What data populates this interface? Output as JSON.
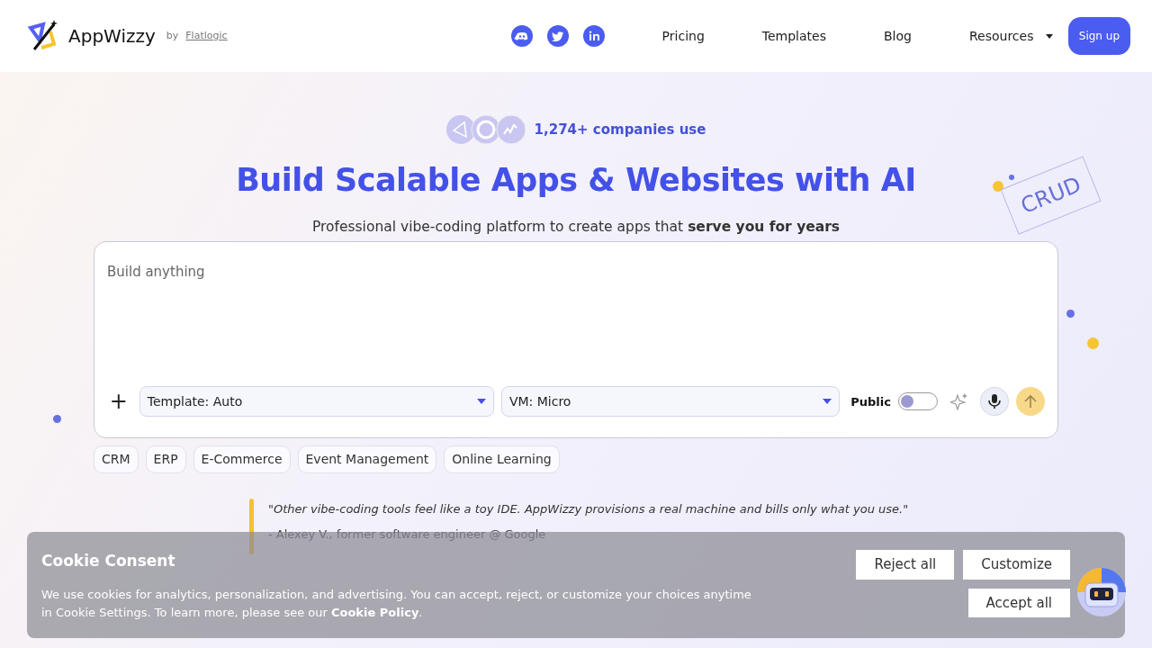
{
  "brand": {
    "name": "AppWizzy",
    "by": "by",
    "company": "Flatlogic"
  },
  "nav": {
    "links": [
      {
        "label": "Pricing",
        "kind": "link"
      },
      {
        "label": "Templates",
        "kind": "link"
      },
      {
        "label": "Blog",
        "kind": "link"
      },
      {
        "label": "Resources",
        "kind": "dropdown"
      }
    ],
    "signup": "Sign up"
  },
  "social": [
    {
      "kind": "discord"
    },
    {
      "kind": "twitter"
    },
    {
      "kind": "linkedin"
    }
  ],
  "hero": {
    "usage": "1,274+ companies use",
    "title": "Build Scalable Apps & Websites with AI",
    "subtitle": "Professional vibe-coding platform to create apps that **serve you for years**",
    "deco_label": "CRUD"
  },
  "prompt": {
    "placeholder": "Build anything",
    "add": "+",
    "template": "Template: Auto",
    "vm": "VM: Micro",
    "public_label": "Public",
    "public_on": false
  },
  "tags": [
    "CRM",
    "ERP",
    "E-Commerce",
    "Event Management",
    "Online Learning"
  ],
  "quote": {
    "text": "\"Other vibe-coding tools feel like a toy IDE. AppWizzy provisions a real machine and bills only what you use.\"",
    "author": "- Alexey V., former software engineer @ Google"
  },
  "cookie": {
    "title": "Cookie Consent",
    "text": "We use cookies for analytics, personalization, and advertising. You can accept, reject, or customize your choices anytime in Cookie Settings. To learn more, please see our **Cookie Policy**.",
    "buttons": [
      "Reject all",
      "Customize",
      "Accept all"
    ]
  }
}
